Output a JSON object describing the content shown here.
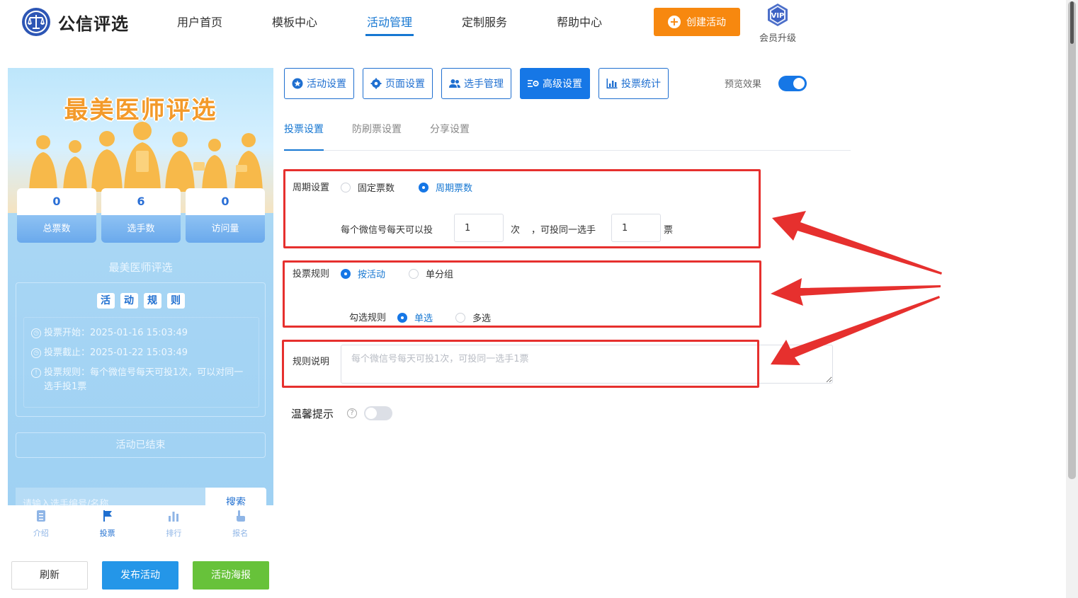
{
  "brand": {
    "name": "公信评选"
  },
  "nav": [
    {
      "label": "用户首页"
    },
    {
      "label": "模板中心"
    },
    {
      "label": "活动管理"
    },
    {
      "label": "定制服务"
    },
    {
      "label": "帮助中心"
    }
  ],
  "header": {
    "create_label": "创建活动",
    "vip_badge": "VIP",
    "vip_label": "会员升级"
  },
  "phone": {
    "banner_title": "最美医师评选",
    "stats": [
      {
        "value": "0",
        "label": "总票数"
      },
      {
        "value": "6",
        "label": "选手数"
      },
      {
        "value": "0",
        "label": "访问量"
      }
    ],
    "subtitle": "最美医师评选",
    "rules_title": [
      "活",
      "动",
      "规",
      "则"
    ],
    "rule_lines": [
      {
        "text": "投票开始：2025-01-16 15:03:49"
      },
      {
        "text": "投票截止：2025-01-22 15:03:49"
      },
      {
        "text": "投票规则：每个微信号每天可投1次，可以对同一选手投1票"
      }
    ],
    "ended": "活动已结束",
    "search_placeholder": "请输入选手编号/名称",
    "search_button": "搜索",
    "tabs": [
      {
        "label": "介绍"
      },
      {
        "label": "投票"
      },
      {
        "label": "排行"
      },
      {
        "label": "报名"
      }
    ]
  },
  "actions": {
    "refresh": "刷新",
    "publish": "发布活动",
    "poster": "活动海报"
  },
  "toolbar": [
    {
      "label": "活动设置"
    },
    {
      "label": "页面设置"
    },
    {
      "label": "选手管理"
    },
    {
      "label": "高级设置"
    },
    {
      "label": "投票统计"
    }
  ],
  "preview_label": "预览效果",
  "subtabs": [
    {
      "label": "投票设置"
    },
    {
      "label": "防刷票设置"
    },
    {
      "label": "分享设置"
    }
  ],
  "form": {
    "cycle": {
      "label": "周期设置",
      "options": [
        "固定票数",
        "周期票数"
      ],
      "selected": "周期票数",
      "per_day_label": "每个微信号每天可以投",
      "per_day_value": "1",
      "times_unit": "次",
      "same_player_label": "，可投同一选手",
      "same_player_value": "1",
      "votes_unit": "票"
    },
    "rule": {
      "label": "投票规则",
      "options": [
        "按活动",
        "单分组"
      ],
      "selected": "按活动",
      "check_label": "勾选规则",
      "check_options": [
        "单选",
        "多选"
      ],
      "check_selected": "单选"
    },
    "description": {
      "label": "规则说明",
      "placeholder": "每个微信号每天可投1次，可投同一选手1票"
    },
    "tip": {
      "label": "温馨提示",
      "help": "?"
    }
  },
  "colors": {
    "primary": "#1677e6",
    "orange": "#f7880f",
    "green": "#67c23a",
    "annotation_red": "#e6302e"
  }
}
